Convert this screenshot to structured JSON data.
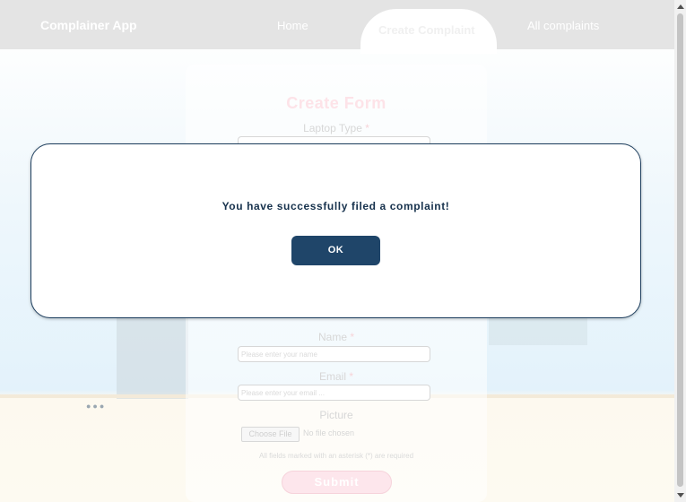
{
  "nav": {
    "brand": "Complainer App",
    "home": "Home",
    "create": "Create Complaint",
    "all": "All complaints"
  },
  "form": {
    "title": "Create Form",
    "laptop_label": "Laptop Type",
    "name_label": "Name",
    "name_placeholder": "Please enter your name",
    "email_label": "Email",
    "email_placeholder": "Please enter your email ...",
    "picture_label": "Picture",
    "file_button": "Choose File",
    "file_status": "No file chosen",
    "required_note": "All fields marked with an asterisk (*) are required",
    "required_marker": "*",
    "submit": "Submit"
  },
  "modal": {
    "message": "You have successfully filed a complaint!",
    "ok": "OK"
  },
  "colors": {
    "accent": "#1f4569",
    "nav_bg": "#e4e4e4"
  }
}
